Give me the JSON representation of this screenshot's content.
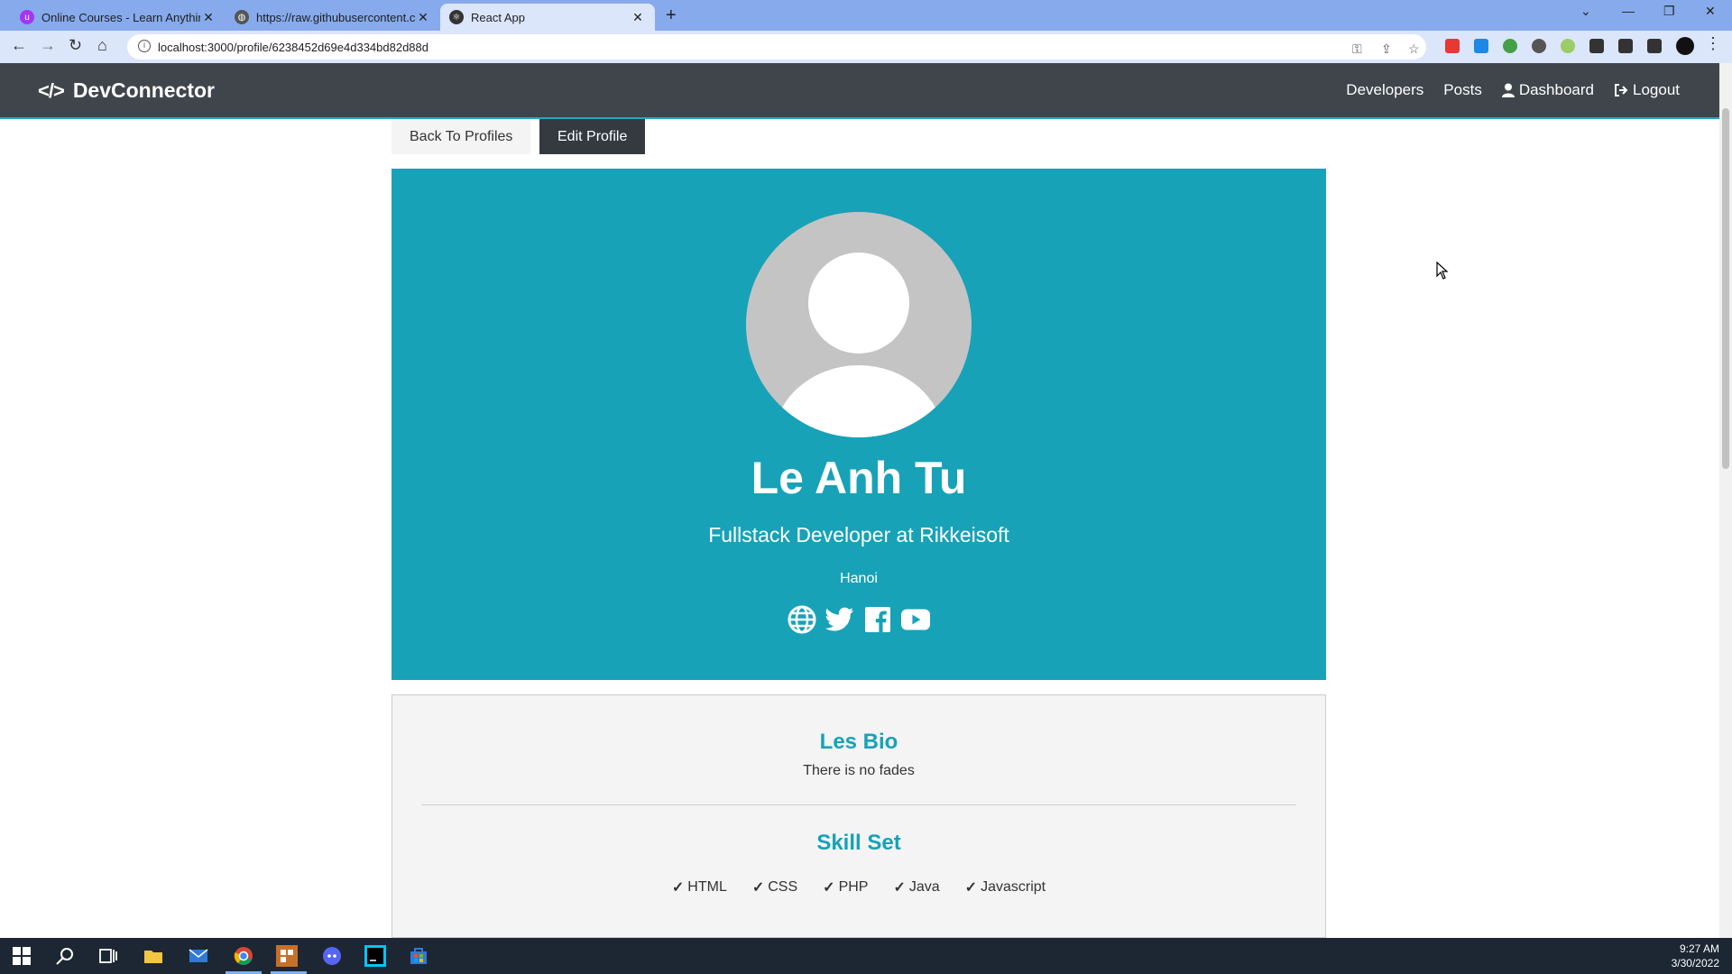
{
  "browser": {
    "tabs": [
      {
        "title": "Online Courses - Learn Anything",
        "favicon": "udemy-icon",
        "color": "#a435f0"
      },
      {
        "title": "https://raw.githubusercontent.co",
        "favicon": "globe-icon",
        "color": "#555555"
      },
      {
        "title": "React App",
        "favicon": "react-icon",
        "color": "#333333"
      }
    ],
    "url": "localhost:3000/profile/6238452d69e4d334bd82d88d"
  },
  "navbar": {
    "brand": "DevConnector",
    "brand_icon": "code-icon",
    "links": {
      "developers": "Developers",
      "posts": "Posts",
      "dashboard": "Dashboard",
      "logout": "Logout"
    }
  },
  "actions": {
    "back": "Back To Profiles",
    "edit": "Edit Profile"
  },
  "profile": {
    "name": "Le Anh Tu",
    "status": "Fullstack Developer at Rikkeisoft",
    "location": "Hanoi",
    "social_icons": [
      "globe-icon",
      "twitter-icon",
      "facebook-icon",
      "youtube-icon"
    ]
  },
  "about": {
    "bio_title": "Les Bio",
    "bio": "There is no fades",
    "skills_title": "Skill Set",
    "skills": [
      "HTML",
      "CSS",
      "PHP",
      "Java",
      "Javascript"
    ]
  },
  "taskbar": {
    "time": "9:27 AM",
    "date": "3/30/2022"
  },
  "colors": {
    "primary": "#17a2b8",
    "dark": "#343a40",
    "light": "#f4f4f4"
  }
}
